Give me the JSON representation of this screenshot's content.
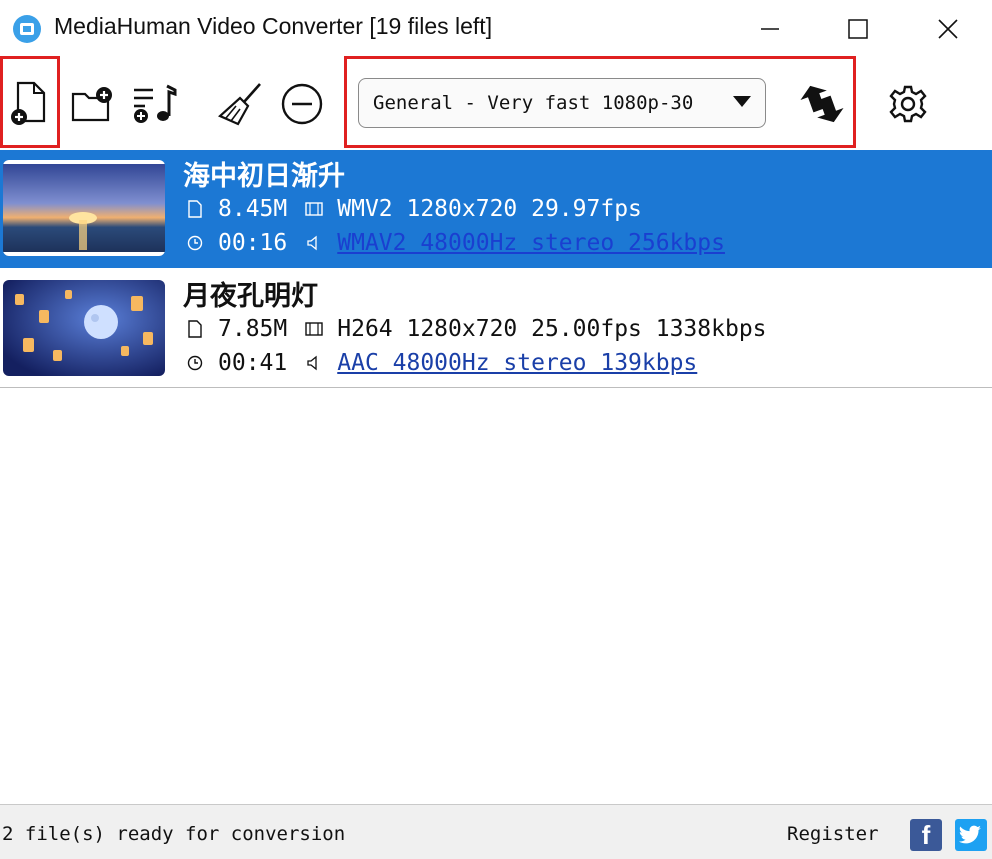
{
  "window": {
    "title": "MediaHuman Video Converter [19 files left]",
    "minimize_icon": "minimize-icon",
    "maximize_icon": "maximize-icon",
    "close_icon": "close-icon"
  },
  "toolbar": {
    "buttons": [
      {
        "name": "add-files-button",
        "icon": "add-file-icon"
      },
      {
        "name": "add-folder-button",
        "icon": "add-folder-icon"
      },
      {
        "name": "add-music-button",
        "icon": "add-music-icon"
      },
      {
        "name": "clear-list-button",
        "icon": "broom-icon"
      },
      {
        "name": "remove-button",
        "icon": "minus-circle-icon"
      }
    ],
    "preset": "General - Very fast 1080p-30",
    "convert_icon": "convert-arrows-icon",
    "settings_icon": "gear-icon",
    "highlight_color": "#e02020"
  },
  "files": [
    {
      "title": "海中初日渐升",
      "size": "8.45M",
      "video": "WMV2 1280x720 29.97fps",
      "duration": "00:16",
      "audio": "WMAV2 48000Hz stereo 256kbps",
      "selected": true
    },
    {
      "title": "月夜孔明灯",
      "size": "7.85M",
      "video": "H264 1280x720 25.00fps 1338kbps",
      "duration": "00:41",
      "audio": "AAC 48000Hz stereo 139kbps",
      "selected": false
    }
  ],
  "status": {
    "text": "2 file(s) ready for conversion",
    "register": "Register"
  },
  "colors": {
    "selection": "#1c78d4",
    "facebook": "#3b5998",
    "twitter": "#1da1f2"
  }
}
